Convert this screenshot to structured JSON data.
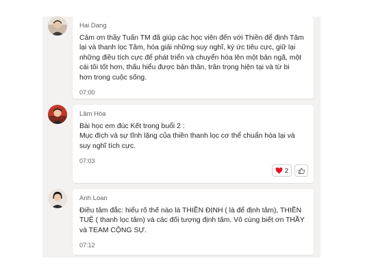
{
  "messages": [
    {
      "author": "Hai Dang",
      "text": "Cảm ơn thầy Tuấn TM đã giúp các học viên đến với Thiền để định  Tâm\nlại và thanh lọc Tâm, hóa giải những suy nghĩ, ký ức tiêu cực, giữ lại\nnhững điều tích cực để phát triển và chuyển hóa lên một bản ngã, một\ncái tôi tốt hơn, thấu hiểu được bản thân, trân trọng hiện tại và từ bi\nhơn trong cuộc sống.",
      "time": "07:00",
      "avatar_icon": "person-avatar-icon"
    },
    {
      "author": "Lâm Hòa",
      "text": "Bài học em đúc Kết trong buổi 2 :\nMục đích và sự tĩnh lặng của thiền thanh lọc cơ thể chuẩn hóa lại và\nsuy nghĩ tích cực.",
      "time": "07:03",
      "avatar_icon": "person-avatar-icon",
      "reactions": [
        {
          "icon": "heart-icon",
          "count": "2",
          "color": "#e81123"
        },
        {
          "icon": "thumbs-up-icon"
        }
      ]
    },
    {
      "author": "Anh Loan",
      "text": "Điều tâm đắc: hiểu rõ thế nào là THIỀN ĐỊNH ( là để định tâm), THIỀN\nTUỆ ( thanh lọc tâm) và các đối tượng định tâm. Vô cùng biết ơn THẦY\nvà TEAM CỘNG SỰ.",
      "time": "07:12",
      "avatar_icon": "person-avatar-icon"
    }
  ],
  "colors": {
    "panel_background": "#f3f2f1",
    "bubble_background": "#ffffff",
    "author_text": "#605e5c",
    "body_text": "#242424",
    "heart": "#e81123"
  }
}
